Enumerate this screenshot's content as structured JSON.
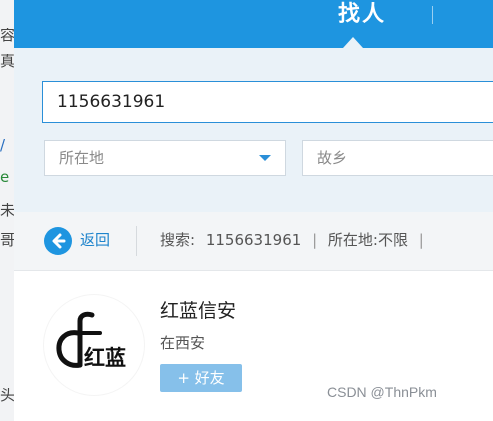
{
  "background_window": {
    "glyphs": [
      "容",
      "真",
      "/",
      "e",
      "未",
      "哥",
      "头"
    ]
  },
  "header": {
    "active_tab": "找人",
    "accent_color": "#1e95e0"
  },
  "search": {
    "value": "1156631961",
    "location_placeholder": "所在地",
    "hometown_placeholder": "故乡"
  },
  "result_bar": {
    "back_label": "返回",
    "summary_prefix": "搜索:",
    "summary_query": "1156631961",
    "summary_location": "所在地:不限",
    "icons": [
      "back-arrow-icon"
    ]
  },
  "results": [
    {
      "name": "红蓝信安",
      "location": "在西安",
      "add_label": "+ 好友",
      "avatar_text": "红蓝"
    }
  ],
  "watermark": "CSDN @ThnPkm"
}
